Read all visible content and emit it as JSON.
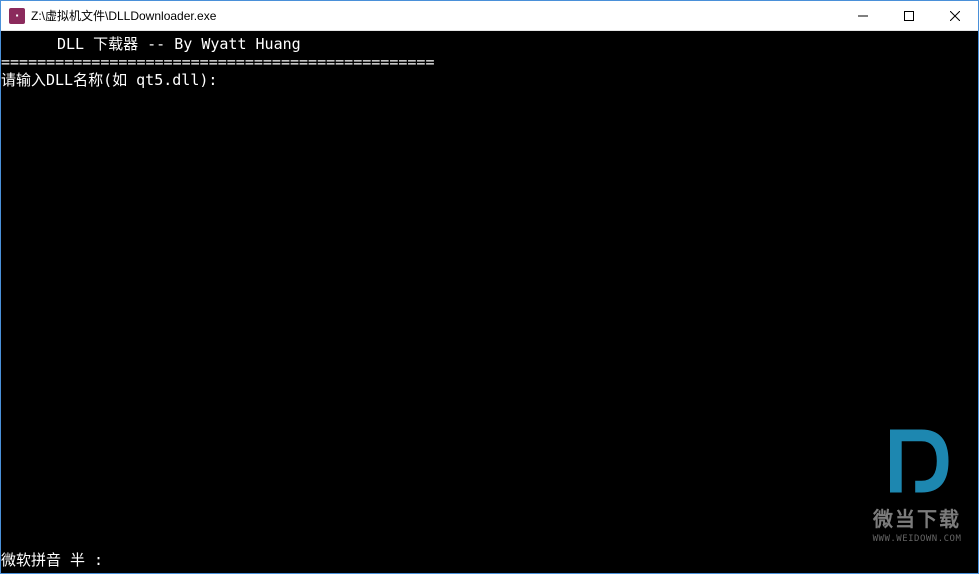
{
  "window": {
    "title": "Z:\\虚拟机文件\\DLLDownloader.exe",
    "icon_label": "app"
  },
  "console": {
    "header_line": "DLL 下载器 -- By Wyatt Huang",
    "separator": "================================================",
    "prompt": "请输入DLL名称(如 qt5.dll):",
    "ime_status": "微软拼音 半 :"
  },
  "watermark": {
    "title_cn": "微当下载",
    "url": "WWW.WEIDOWN.COM"
  }
}
